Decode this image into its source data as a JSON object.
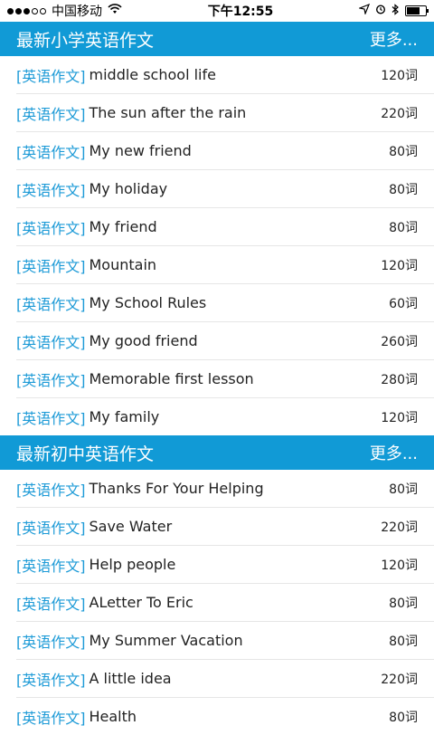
{
  "status_bar": {
    "carrier": "中国移动",
    "time": "下午12:55"
  },
  "sections": [
    {
      "title": "最新小学英语作文",
      "more": "更多...",
      "items": [
        {
          "tag": "[英语作文]",
          "title": "middle school life",
          "count": "120词"
        },
        {
          "tag": "[英语作文]",
          "title": "The sun after the rain",
          "count": "220词"
        },
        {
          "tag": "[英语作文]",
          "title": "My new friend",
          "count": "80词"
        },
        {
          "tag": "[英语作文]",
          "title": "My holiday",
          "count": "80词"
        },
        {
          "tag": "[英语作文]",
          "title": "My friend",
          "count": "80词"
        },
        {
          "tag": "[英语作文]",
          "title": "Mountain",
          "count": "120词"
        },
        {
          "tag": "[英语作文]",
          "title": "My School Rules",
          "count": "60词"
        },
        {
          "tag": "[英语作文]",
          "title": "My good friend",
          "count": "260词"
        },
        {
          "tag": "[英语作文]",
          "title": "Memorable first lesson",
          "count": "280词"
        },
        {
          "tag": "[英语作文]",
          "title": "My family",
          "count": "120词"
        }
      ]
    },
    {
      "title": "最新初中英语作文",
      "more": "更多...",
      "items": [
        {
          "tag": "[英语作文]",
          "title": "Thanks For Your Helping",
          "count": "80词"
        },
        {
          "tag": "[英语作文]",
          "title": "Save Water",
          "count": "220词"
        },
        {
          "tag": "[英语作文]",
          "title": "Help people",
          "count": "120词"
        },
        {
          "tag": "[英语作文]",
          "title": "ALetter To Eric",
          "count": "80词"
        },
        {
          "tag": "[英语作文]",
          "title": "My Summer Vacation",
          "count": "80词"
        },
        {
          "tag": "[英语作文]",
          "title": "A little idea",
          "count": "220词"
        },
        {
          "tag": "[英语作文]",
          "title": "Health",
          "count": "80词"
        }
      ]
    }
  ]
}
